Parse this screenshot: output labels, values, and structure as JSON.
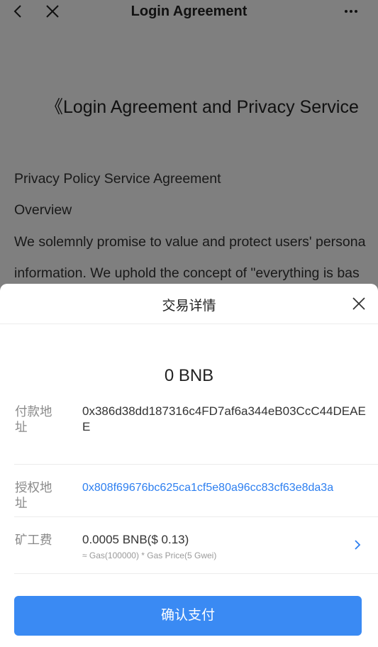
{
  "header": {
    "title": "Login Agreement"
  },
  "document": {
    "title": "《Login Agreement and Privacy Service",
    "lines": [
      "Privacy Policy Service Agreement",
      "Overview",
      "We solemnly promise to value and protect users' persona",
      "information. We uphold the concept of \"everything is bas"
    ]
  },
  "sheet": {
    "title": "交易详情",
    "amount": "0 BNB",
    "payment_label": "付款地址",
    "payment_value": "0x386d38dd187316c4FD7af6a344eB03CcC44DEAEE",
    "auth_label": "授权地址",
    "auth_value": "0x808f69676bc625ca1cf5e80a96cc83cf63e8da3a",
    "fee_label": "矿工费",
    "fee_value": "0.0005 BNB($ 0.13)",
    "fee_detail": "≈ Gas(100000) * Gas Price(5 Gwei)",
    "confirm_label": "确认支付"
  },
  "colors": {
    "accent": "#3a8af3",
    "link": "#2d7ff0",
    "overlay": "rgba(0,0,0,0.5)"
  }
}
